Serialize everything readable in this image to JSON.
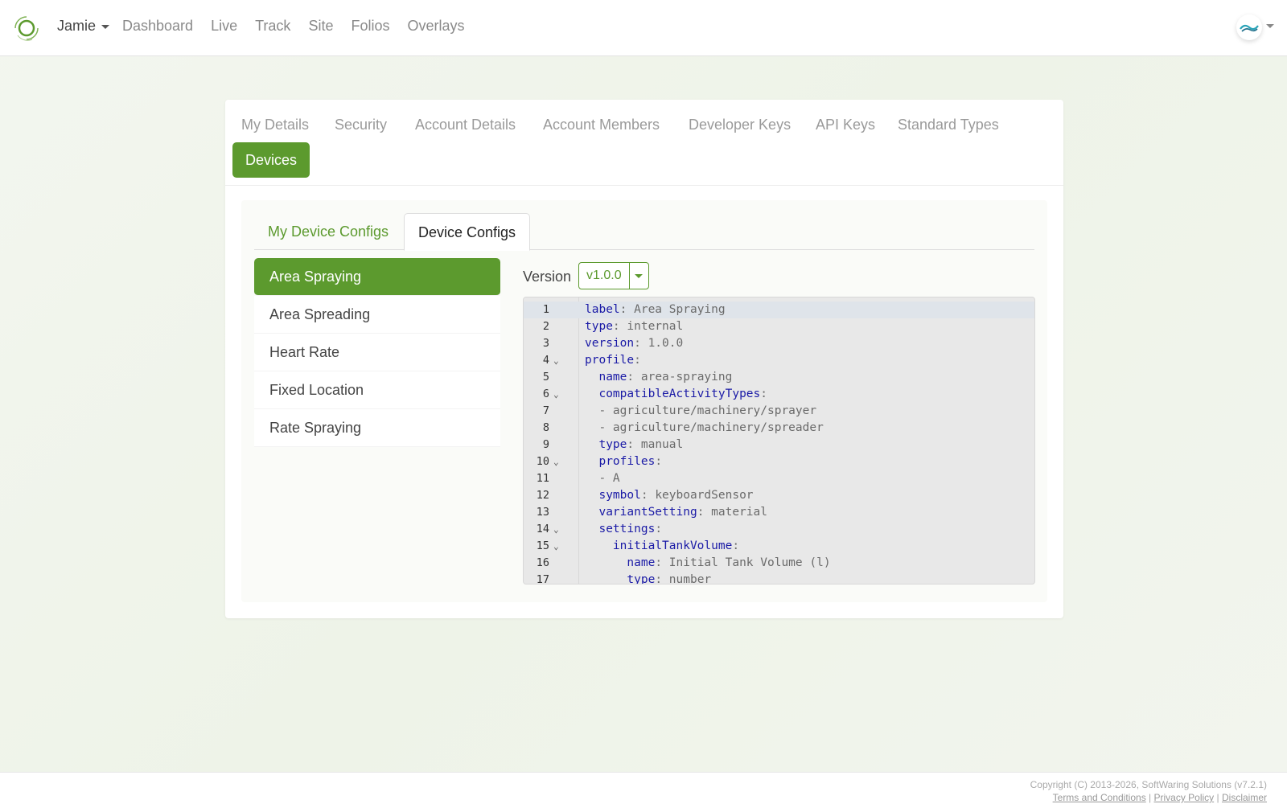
{
  "navbar": {
    "user": "Jamie",
    "links": [
      "Dashboard",
      "Live",
      "Track",
      "Site",
      "Folios",
      "Overlays"
    ],
    "logo_icon": "ring-logo-icon",
    "avatar_icon": "wave-avatar-icon"
  },
  "settings_tabs": [
    "My Details",
    "Security",
    "Account Details",
    "Account Members",
    "Developer Keys",
    "API Keys",
    "Standard Types",
    "Devices"
  ],
  "active_settings_tab": "Devices",
  "device_tabs": {
    "my_configs": "My Device Configs",
    "configs": "Device Configs"
  },
  "device_list": [
    "Area Spraying",
    "Area Spreading",
    "Heart Rate",
    "Fixed Location",
    "Rate Spraying"
  ],
  "active_device": "Area Spraying",
  "version": {
    "label": "Version",
    "value": "v1.0.0"
  },
  "editor": {
    "lines": [
      {
        "n": "1",
        "indent": "",
        "key": "label",
        "value": " Area Spraying",
        "fold": ""
      },
      {
        "n": "2",
        "indent": "",
        "key": "type",
        "value": " internal",
        "fold": ""
      },
      {
        "n": "3",
        "indent": "",
        "key": "version",
        "value": " 1.0.0",
        "fold": ""
      },
      {
        "n": "4",
        "indent": "",
        "key": "profile",
        "value": "",
        "fold": "⌄"
      },
      {
        "n": "5",
        "indent": "  ",
        "key": "name",
        "value": " area-spraying",
        "fold": ""
      },
      {
        "n": "6",
        "indent": "  ",
        "key": "compatibleActivityTypes",
        "value": "",
        "fold": "⌄"
      },
      {
        "n": "7",
        "indent": "  ",
        "key": "",
        "value": "- agriculture/machinery/sprayer",
        "fold": ""
      },
      {
        "n": "8",
        "indent": "  ",
        "key": "",
        "value": "- agriculture/machinery/spreader",
        "fold": ""
      },
      {
        "n": "9",
        "indent": "  ",
        "key": "type",
        "value": " manual",
        "fold": ""
      },
      {
        "n": "10",
        "indent": "  ",
        "key": "profiles",
        "value": "",
        "fold": "⌄"
      },
      {
        "n": "11",
        "indent": "  ",
        "key": "",
        "value": "- A",
        "fold": ""
      },
      {
        "n": "12",
        "indent": "  ",
        "key": "symbol",
        "value": " keyboardSensor",
        "fold": ""
      },
      {
        "n": "13",
        "indent": "  ",
        "key": "variantSetting",
        "value": " material",
        "fold": ""
      },
      {
        "n": "14",
        "indent": "  ",
        "key": "settings",
        "value": "",
        "fold": "⌄"
      },
      {
        "n": "15",
        "indent": "    ",
        "key": "initialTankVolume",
        "value": "",
        "fold": "⌄"
      },
      {
        "n": "16",
        "indent": "      ",
        "key": "name",
        "value": " Initial Tank Volume (l)",
        "fold": ""
      },
      {
        "n": "17",
        "indent": "      ",
        "key": "type",
        "value": " number",
        "fold": ""
      }
    ]
  },
  "footer": {
    "copyright": "Copyright (C) 2013-2026, SoftWaring Solutions (v7.2.1)",
    "terms": "Terms and Conditions",
    "privacy": "Privacy Policy",
    "disclaimer": "Disclaimer",
    "separator": " | "
  },
  "colors": {
    "accent": "#5c9a2e",
    "yaml_key": "#1a1aa6"
  }
}
